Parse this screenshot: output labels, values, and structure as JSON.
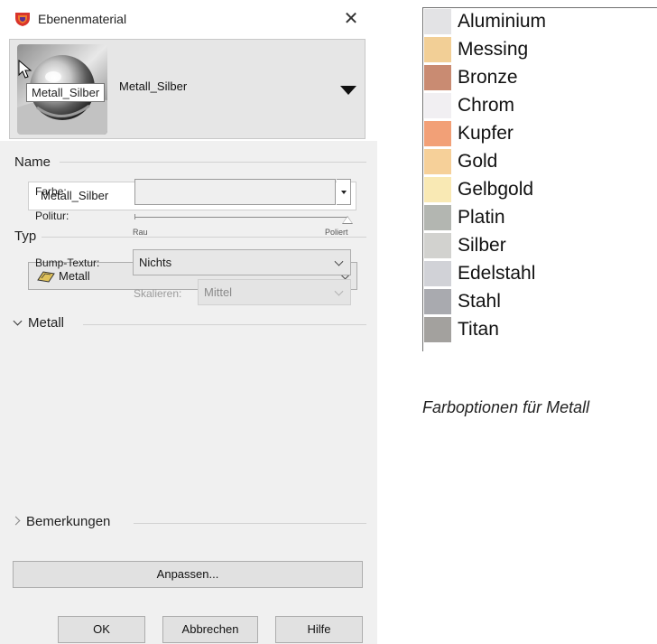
{
  "dialog": {
    "title": "Ebenenmaterial",
    "close_glyph": "✕",
    "preview": {
      "material_name": "Metall_Silber",
      "tooltip": "Metall_Silber"
    },
    "name_section": {
      "label": "Name",
      "value": "Metall_Silber"
    },
    "type_section": {
      "label": "Typ",
      "selected": "Metall"
    },
    "metal_section": {
      "label": "Metall",
      "color_label": "Farbe:",
      "polish_label": "Politur:",
      "polish_min": "Rau",
      "polish_max": "Poliert",
      "polish_value": 1.0,
      "bump_label": "Bump-Textur:",
      "bump_value": "Nichts",
      "scale_label": "Skalieren:",
      "scale_value": "Mittel"
    },
    "notes_section": {
      "label": "Bemerkungen"
    },
    "customize_button": "Anpassen...",
    "ok_button": "OK",
    "cancel_button": "Abbrechen",
    "help_button": "Hilfe"
  },
  "metal_colors": [
    {
      "name": "Aluminium",
      "color": "#e3e3e5"
    },
    {
      "name": "Messing",
      "color": "#f2cf96"
    },
    {
      "name": "Bronze",
      "color": "#c98b72"
    },
    {
      "name": "Chrom",
      "color": "#f1eff2"
    },
    {
      "name": "Kupfer",
      "color": "#f2a077"
    },
    {
      "name": "Gold",
      "color": "#f6d099"
    },
    {
      "name": "Gelbgold",
      "color": "#f9e9b4"
    },
    {
      "name": "Platin",
      "color": "#b3b6b1"
    },
    {
      "name": "Silber",
      "color": "#d2d2cf"
    },
    {
      "name": "Edelstahl",
      "color": "#d1d2d7"
    },
    {
      "name": "Stahl",
      "color": "#a9aaaf"
    },
    {
      "name": "Titan",
      "color": "#a3a19e"
    }
  ],
  "caption": "Farboptionen für Metall"
}
